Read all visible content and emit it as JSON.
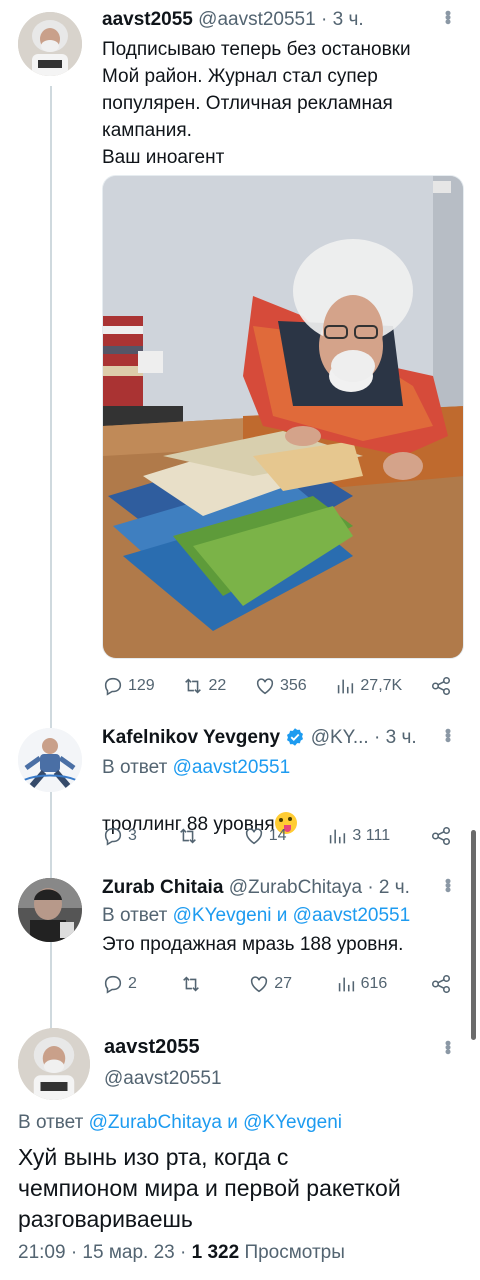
{
  "tweets": [
    {
      "name": "aavst2055",
      "handle": "@aavst20551",
      "sep": "·",
      "time": "3 ч.",
      "text": "Подписываю теперь без остановки\nМой район. Журнал стал супер\nпопулярен. Отличная рекламная\nкампания.\nВаш иноагент",
      "photo_desc": "magazines",
      "stats": {
        "replies": "129",
        "retweets": "22",
        "likes": "356",
        "views": "27,7K"
      }
    },
    {
      "name": "Kafelnikov Yevgeny",
      "handle": "@KY...",
      "sep": "·",
      "time": "3 ч.",
      "reply_prefix": "В ответ",
      "reply_to": "@aavst20551",
      "text": "троллинг 88 уровня",
      "stats": {
        "replies": "3",
        "retweets": "",
        "likes": "14",
        "views": "3 111"
      }
    },
    {
      "name": "Zurab Chitaia",
      "handle": "@ZurabChitaya",
      "sep": "·",
      "time": "2 ч.",
      "reply_prefix": "В ответ",
      "reply_to": "@KYevgeni и @aavst20551",
      "text": "Это продажная мразь 188 уровня.",
      "stats": {
        "replies": "2",
        "retweets": "",
        "likes": "27",
        "views": "616"
      }
    }
  ],
  "focus": {
    "name": "aavst2055",
    "handle": "@aavst20551",
    "reply_prefix": "В ответ",
    "reply_to": "@ZurabChitaya и @KYevgeni",
    "text": "Хуй вынь изо рта, когда с\nчемпионом мира и первой ракеткой\nразговариваешь",
    "time": "21:09 · 15 мар. 23 ·",
    "views_count": "1 322",
    "views_label": "Просмотры"
  },
  "colors": {
    "link": "#1d9bf0",
    "secondary": "#536471",
    "line": "#cfd9de"
  }
}
